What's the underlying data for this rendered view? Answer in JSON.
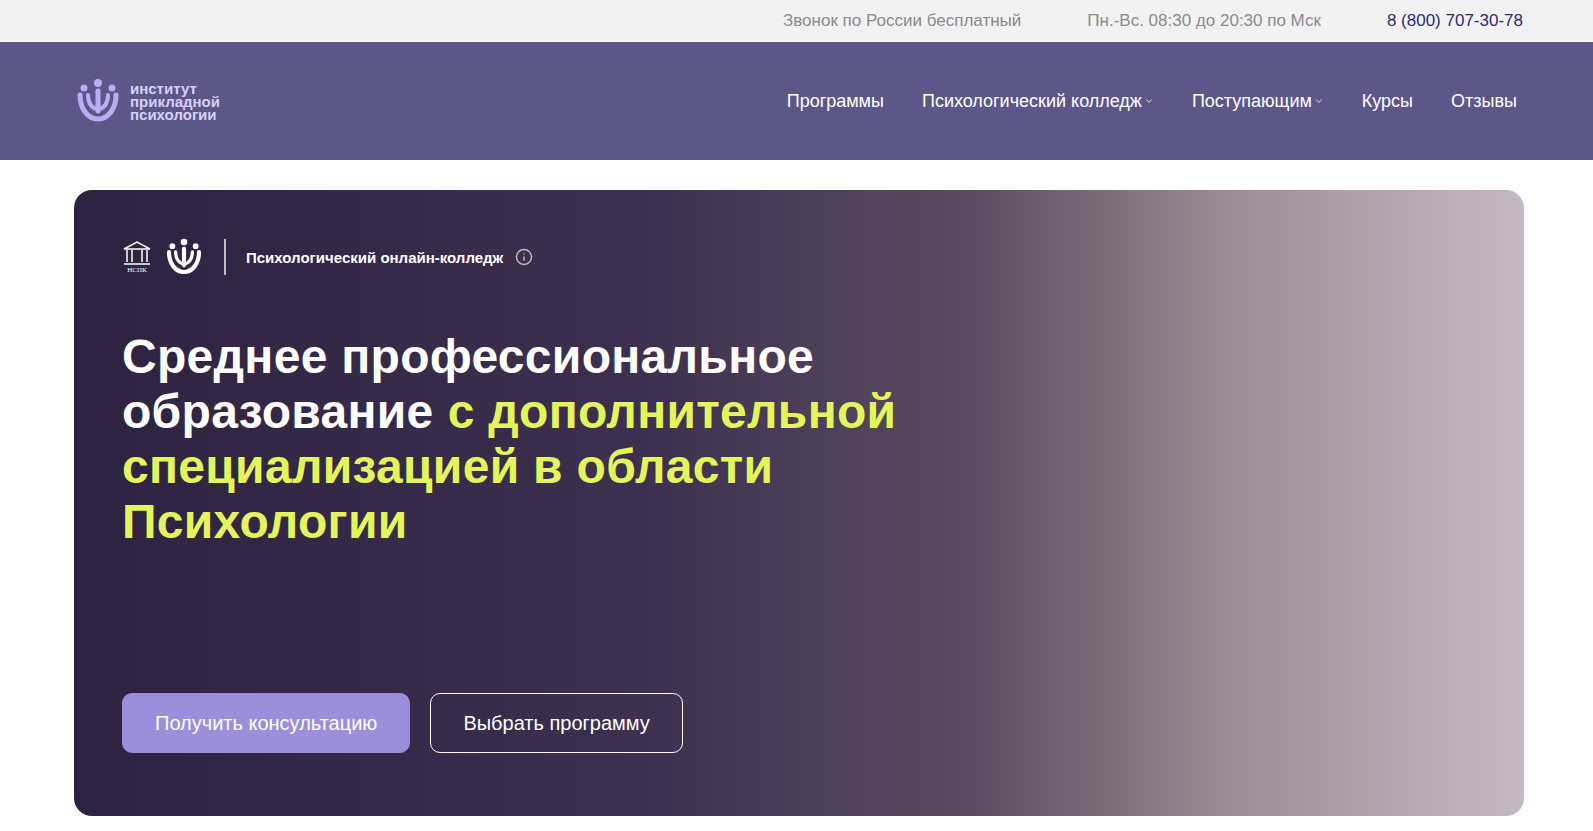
{
  "topbar": {
    "items": [
      "Звонок по России бесплатный",
      "Пн.-Вс. 08:30 до 20:30 по Мск"
    ],
    "phone": "8 (800) 707-30-78"
  },
  "logo": {
    "lines": [
      "институт",
      "прикладной",
      "психологии"
    ]
  },
  "nav": [
    {
      "label": "Программы",
      "dropdown": false
    },
    {
      "label": "Психологический колледж",
      "dropdown": true
    },
    {
      "label": "Поступающим",
      "dropdown": true
    },
    {
      "label": "Курсы",
      "dropdown": false
    },
    {
      "label": "Отзывы",
      "dropdown": false
    }
  ],
  "hero": {
    "partner_logo_text": "НСПК",
    "badge": "Психологический онлайн-колледж",
    "headline": [
      [
        {
          "text": "Среднее профессиональное",
          "highlight": false
        }
      ],
      [
        {
          "text": "образование",
          "highlight": false
        },
        {
          "text": "с дополнительной",
          "highlight": true
        }
      ],
      [
        {
          "text": "специализацией в области",
          "highlight": true
        }
      ],
      [
        {
          "text": "Психологии",
          "highlight": true
        }
      ]
    ],
    "buttons": [
      {
        "label": "Получить консультацию",
        "kind": "primary"
      },
      {
        "label": "Выбрать программу",
        "kind": "outline"
      }
    ]
  }
}
